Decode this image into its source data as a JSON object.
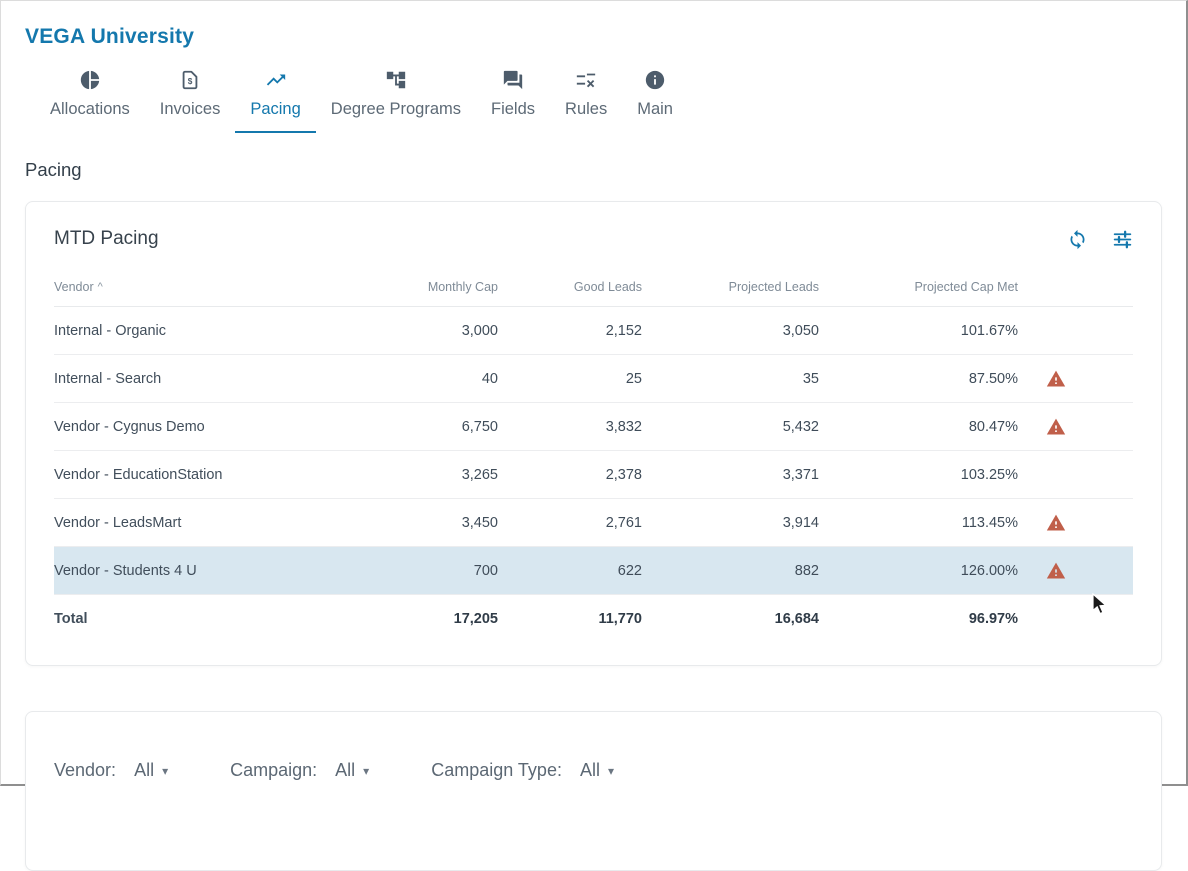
{
  "app": {
    "title": "VEGA University"
  },
  "tabs": [
    {
      "label": "Allocations",
      "icon": "pie-chart-icon",
      "active": false
    },
    {
      "label": "Invoices",
      "icon": "invoice-document-icon",
      "active": false
    },
    {
      "label": "Pacing",
      "icon": "trending-up-icon",
      "active": true
    },
    {
      "label": "Degree Programs",
      "icon": "hierarchy-tree-icon",
      "active": false
    },
    {
      "label": "Fields",
      "icon": "chat-bubbles-icon",
      "active": false
    },
    {
      "label": "Rules",
      "icon": "rules-list-icon",
      "active": false
    },
    {
      "label": "Main",
      "icon": "info-icon",
      "active": false
    }
  ],
  "page": {
    "title": "Pacing"
  },
  "mtd_pacing": {
    "title": "MTD Pacing",
    "columns": [
      "Vendor",
      "Monthly Cap",
      "Good Leads",
      "Projected Leads",
      "Projected Cap Met"
    ],
    "sort": {
      "column": "Vendor",
      "direction": "asc"
    },
    "rows": [
      {
        "vendor": "Internal - Organic",
        "monthly_cap": "3,000",
        "good_leads": "2,152",
        "projected_leads": "3,050",
        "projected_cap_met": "101.67%",
        "warning": false,
        "highlighted": false
      },
      {
        "vendor": "Internal - Search",
        "monthly_cap": "40",
        "good_leads": "25",
        "projected_leads": "35",
        "projected_cap_met": "87.50%",
        "warning": true,
        "highlighted": false
      },
      {
        "vendor": "Vendor - Cygnus Demo",
        "monthly_cap": "6,750",
        "good_leads": "3,832",
        "projected_leads": "5,432",
        "projected_cap_met": "80.47%",
        "warning": true,
        "highlighted": false
      },
      {
        "vendor": "Vendor - EducationStation",
        "monthly_cap": "3,265",
        "good_leads": "2,378",
        "projected_leads": "3,371",
        "projected_cap_met": "103.25%",
        "warning": false,
        "highlighted": false
      },
      {
        "vendor": "Vendor - LeadsMart",
        "monthly_cap": "3,450",
        "good_leads": "2,761",
        "projected_leads": "3,914",
        "projected_cap_met": "113.45%",
        "warning": true,
        "highlighted": false
      },
      {
        "vendor": "Vendor - Students 4 U",
        "monthly_cap": "700",
        "good_leads": "622",
        "projected_leads": "882",
        "projected_cap_met": "126.00%",
        "warning": true,
        "highlighted": true
      }
    ],
    "total": {
      "label": "Total",
      "monthly_cap": "17,205",
      "good_leads": "11,770",
      "projected_leads": "16,684",
      "projected_cap_met": "96.97%"
    }
  },
  "filters": {
    "vendor_label": "Vendor:",
    "vendor_value": "All",
    "campaign_label": "Campaign:",
    "campaign_value": "All",
    "campaign_type_label": "Campaign Type:",
    "campaign_type_value": "All"
  },
  "colors": {
    "accent": "#1478ad",
    "warning": "#c05f4a",
    "row_highlight": "#d8e7f0"
  }
}
